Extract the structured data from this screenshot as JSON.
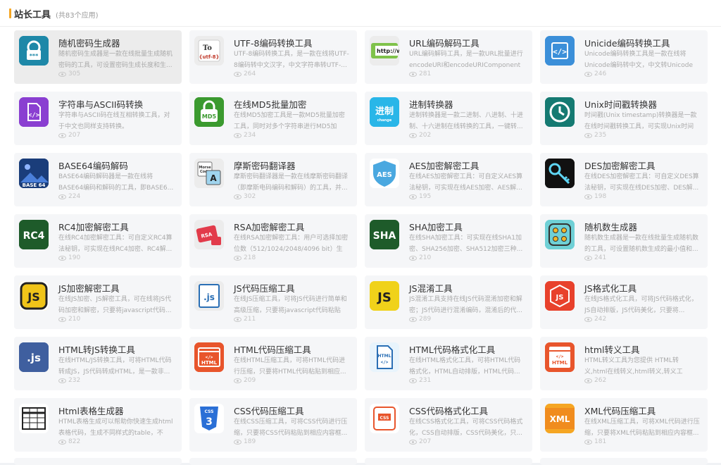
{
  "section": {
    "title": "站长工具",
    "subtitle": "(共83个应用)",
    "accent": "#f5a623"
  },
  "tools": [
    {
      "name": "随机密码生成器",
      "desc": "随机密码生成器是一款在线批量生成随机密码的工具，可设置密码生成长度和生...",
      "views": "305",
      "icon": "lock-key-icon",
      "color": "#1e88a8"
    },
    {
      "name": "UTF-8编码转换工具",
      "desc": "UTF-8编码转换工具，是一款在线将UTF-8编码转中文汉字，中文字符串转UTF-...",
      "views": "264",
      "icon": "utf8-icon",
      "color": "#e8e8e8"
    },
    {
      "name": "URL编码解码工具",
      "desc": "URL编码解码工具，是一款URL批量进行encodeURI和encodeURIComponent两...",
      "views": "281",
      "icon": "url-bar-icon",
      "color": "#e8e8e8"
    },
    {
      "name": "Unicide编码转换工具",
      "desc": "Unicode编码转换工具是一款在线将Unicode编码转中文，中文转Unicode编...",
      "views": "246",
      "icon": "code-brackets-icon",
      "color": "#3b8fd9"
    },
    {
      "name": "字符串与ASCII码转换",
      "desc": "字符串与ASCII码在线互相转换工具，对于中文也同样支持转换。",
      "views": "207",
      "icon": "code-file-icon",
      "color": "#8a3fd1"
    },
    {
      "name": "在线MD5批量加密",
      "desc": "在线MD5加密工具是一款MD5批量加密工具，同时对多个字符串进行MD5加密，...",
      "views": "234",
      "icon": "md5-lock-icon",
      "color": "#3b9a2f"
    },
    {
      "name": "进制转换器",
      "desc": "进制转换器是一款二进制、八进制、十进制、十六进制在线转换的工具，一键转...",
      "views": "202",
      "icon": "base-change-icon",
      "color": "#29b6e8"
    },
    {
      "name": "Unix时间戳转换器",
      "desc": "时间戳(Unix timestamp)转换器是一款在线时间戳转换工具，可实现Unix时间戳...",
      "views": "235",
      "icon": "clock-icon",
      "color": "#157a72"
    },
    {
      "name": "BASE64编码解码",
      "desc": "BASE64编码解码器是一款在线将BASE64编码和解码的工具，即BASE6...",
      "views": "224",
      "icon": "base64-image-icon",
      "color": "#1a3d7a"
    },
    {
      "name": "摩斯密码翻译器",
      "desc": "摩斯密码翻译器是一款在线摩斯密码翻译（即摩斯电码编码和解码）的工具，并...",
      "views": "302",
      "icon": "morse-translate-icon",
      "color": "#e8e8e8"
    },
    {
      "name": "AES加密解密工具",
      "desc": "在线AES加密解密工具：可自定义AES算法秘钥，可实现在线AES加密、AES解...",
      "views": "195",
      "icon": "aes-shield-icon",
      "color": "#ffffff"
    },
    {
      "name": "DES加密解密工具",
      "desc": "在线DES加密解密工具：可自定义DES算法秘钥，可实现在线DES加密、DES解...",
      "views": "198",
      "icon": "key-icon",
      "color": "#111111"
    },
    {
      "name": "RC4加密解密工具",
      "desc": "在线RC4加密解密工具：可自定义RC4算法秘钥，可实现在线RC4加密、RC4解...",
      "views": "190",
      "icon": "rc4-icon",
      "color": "#1e5b2a"
    },
    {
      "name": "RSA加密解密工具",
      "desc": "在线RSA加密解密工具：用户可选择加密位数（512/1024/2048/4096 bit）生成...",
      "views": "218",
      "icon": "rsa-lock-icon",
      "color": "#e8e8e8"
    },
    {
      "name": "SHA加密工具",
      "desc": "在线SHA加密工具：可实现在线SHA1加密、SHA256加密、SHA512加密三种...",
      "views": "210",
      "icon": "sha-icon",
      "color": "#1e5b2a"
    },
    {
      "name": "随机数生成器",
      "desc": "随机数生成器是一款在线批量生成随机数的工具，可设置随机数生成的最小值和...",
      "views": "241",
      "icon": "dice-icon",
      "color": "#6fd0d6"
    },
    {
      "name": "JS加密解密工具",
      "desc": "在线JS加密、JS解密工具，可在线将JS代码加密和解密，只要将javascript代码...",
      "views": "210",
      "icon": "js-badge-icon",
      "color": "#f0c419"
    },
    {
      "name": "JS代码压缩工具",
      "desc": "在线JS压缩工具，可将JS代码进行简单和高级压缩，只要将javascript代码粘贴到...",
      "views": "211",
      "icon": "js-file-icon",
      "color": "#e8e8e8"
    },
    {
      "name": "JS混淆工具",
      "desc": "JS混淆工具支持在线JS代码混淆加密和解密；JS代码进行混淆编码，混淆后的代...",
      "views": "289",
      "icon": "js-square-icon",
      "color": "#f0d21a"
    },
    {
      "name": "JS格式化工具",
      "desc": "在线JS格式化工具，可将JS代码格式化，JS自动排版，JS代码美化，只要将...",
      "views": "242",
      "icon": "js-hexagon-icon",
      "color": "#e8412c"
    },
    {
      "name": "HTML转JS转换工具",
      "desc": "在线HTML/JS转换工具，可将HTML代码转成JS，JS代码转成HTML，是一款非...",
      "views": "232",
      "icon": "js-dot-icon",
      "color": "#3f5f9f"
    },
    {
      "name": "HTML代码压缩工具",
      "desc": "在线HTML压缩工具，可将HTML代码进行压缩，只要将HTML代码粘贴到相应...",
      "views": "209",
      "icon": "html-window-icon",
      "color": "#e8552c"
    },
    {
      "name": "HTML代码格式化工具",
      "desc": "在线HTML格式化工具，可将HTML代码格式化，HTML自动排版，HTML代码...",
      "views": "231",
      "icon": "html-doc-icon",
      "color": "#e8f4fc"
    },
    {
      "name": "html转义工具",
      "desc": "HTML转义工具为您提供 HTML转义,html在线转义,html转义,转义工具,html转义...",
      "views": "262",
      "icon": "html-escape-icon",
      "color": "#e8552c"
    },
    {
      "name": "Html表格生成器",
      "desc": "HTML表格生成可以帮助你快速生成html表格代码，生成不同样式的table，不同...",
      "views": "822",
      "icon": "table-grid-icon",
      "color": "#ffffff"
    },
    {
      "name": "CSS代码压缩工具",
      "desc": "在线CSS压缩工具，可将CSS代码进行压缩，只要将CSS代码粘贴到相应内容框...",
      "views": "189",
      "icon": "css3-shield-icon",
      "color": "#ffffff"
    },
    {
      "name": "CSS代码格式化工具",
      "desc": "在线CSS格式化工具，可将CSS代码格式化，CSS自动排版，CSS代码美化，只...",
      "views": "207",
      "icon": "css-doc-icon",
      "color": "#ffffff"
    },
    {
      "name": "XML代码压缩工具",
      "desc": "在线XML压缩工具，可将XML代码进行压缩，只要将XML代码粘贴到相应内容框...",
      "views": "181",
      "icon": "xml-icon",
      "color": "#f5a623"
    }
  ]
}
